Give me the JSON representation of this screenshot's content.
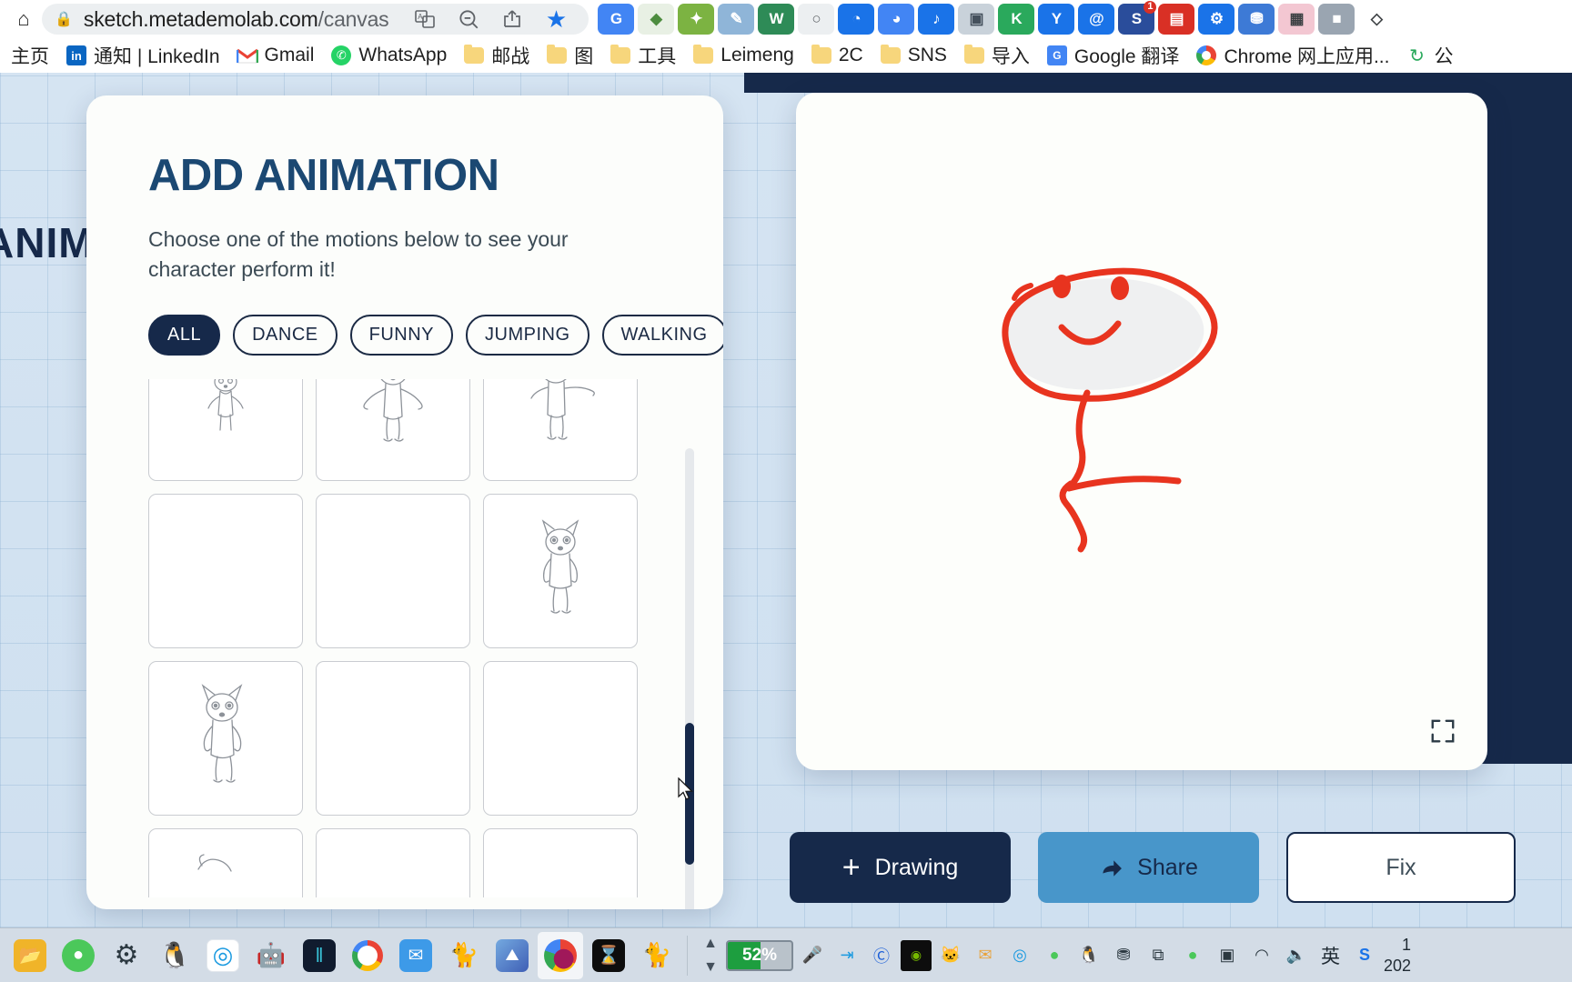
{
  "browser": {
    "home_icon": "home-icon",
    "lock_icon": "lock-icon",
    "url_main": "sketch.metademolab.com",
    "url_path": "/canvas",
    "translate_icon": "translate-icon",
    "zoom_out_icon": "zoom-out-icon",
    "share_icon": "share-icon",
    "bookmark_star_icon": "star-icon",
    "extensions": [
      {
        "name": "translate-extension",
        "glyph": "G",
        "color": "#4285f4",
        "badge": ""
      },
      {
        "name": "puzzle-extension",
        "glyph": "◆",
        "color": "#6aa84f",
        "badge": ""
      },
      {
        "name": "green-extension",
        "glyph": "✦",
        "color": "#6aa84f",
        "badge": ""
      },
      {
        "name": "pen-extension",
        "glyph": "✎",
        "color": "#7a9cc6",
        "badge": ""
      },
      {
        "name": "wps-extension",
        "glyph": "W",
        "color": "#2e8b57",
        "badge": ""
      },
      {
        "name": "circle-extension",
        "glyph": "○",
        "color": "#5f6368",
        "badge": ""
      },
      {
        "name": "blue-swirl-extension",
        "glyph": "◔",
        "color": "#1a73e8",
        "badge": ""
      },
      {
        "name": "cloud-extension",
        "glyph": "◕",
        "color": "#4285f4",
        "badge": ""
      },
      {
        "name": "music-extension",
        "glyph": "♪",
        "color": "#1a73e8",
        "badge": ""
      },
      {
        "name": "robot-extension",
        "glyph": "▣",
        "color": "#9aa5b1",
        "badge": ""
      },
      {
        "name": "kiwi-extension",
        "glyph": "K",
        "color": "#2aa95c",
        "badge": ""
      },
      {
        "name": "yandex-extension",
        "glyph": "Y",
        "color": "#1a73e8",
        "badge": ""
      },
      {
        "name": "mention-extension",
        "glyph": "@",
        "color": "#1a73e8",
        "badge": ""
      },
      {
        "name": "sales-extension",
        "glyph": "S",
        "color": "#2a4d9b",
        "badge": "1"
      },
      {
        "name": "megaphone-extension",
        "glyph": "◤",
        "color": "#d93025",
        "badge": ""
      },
      {
        "name": "settings-extension",
        "glyph": "⚙",
        "color": "#1a73e8",
        "badge": ""
      },
      {
        "name": "shield-extension",
        "glyph": "⛉",
        "color": "#3d7ad6",
        "badge": ""
      },
      {
        "name": "grid-extension",
        "glyph": "▦",
        "color": "#5f6368",
        "badge": ""
      },
      {
        "name": "camera-extension",
        "glyph": "■",
        "color": "#5f6368",
        "badge": ""
      },
      {
        "name": "puzzle-menu-icon",
        "glyph": "◇",
        "color": "#3c4043",
        "badge": ""
      }
    ],
    "bookmarks": [
      {
        "label": "主页",
        "icon": "none"
      },
      {
        "label": "通知 | LinkedIn",
        "icon": "linkedin"
      },
      {
        "label": "Gmail",
        "icon": "gmail"
      },
      {
        "label": "WhatsApp",
        "icon": "whatsapp"
      },
      {
        "label": "邮战",
        "icon": "folder"
      },
      {
        "label": "图",
        "icon": "folder"
      },
      {
        "label": "工具",
        "icon": "folder"
      },
      {
        "label": "Leimeng",
        "icon": "folder"
      },
      {
        "label": "2C",
        "icon": "folder"
      },
      {
        "label": "SNS",
        "icon": "folder"
      },
      {
        "label": "导入",
        "icon": "folder"
      },
      {
        "label": "Google 翻译",
        "icon": "gtranslate"
      },
      {
        "label": "Chrome 网上应用...",
        "icon": "chrome"
      },
      {
        "label": "公",
        "icon": "refresh"
      }
    ]
  },
  "ghost_heading": "ANIM",
  "panel": {
    "title": "ADD ANIMATION",
    "subtitle": "Choose one of the motions below to see your character perform it!",
    "filters": [
      {
        "label": "ALL",
        "active": true
      },
      {
        "label": "DANCE",
        "active": false
      },
      {
        "label": "FUNNY",
        "active": false
      },
      {
        "label": "JUMPING",
        "active": false
      },
      {
        "label": "WALKING",
        "active": false
      }
    ],
    "tiles": [
      {
        "name": "animation-tile-1",
        "pose": "small-standing"
      },
      {
        "name": "animation-tile-2",
        "pose": "arms-out"
      },
      {
        "name": "animation-tile-3",
        "pose": "arm-raised"
      },
      {
        "name": "animation-tile-4",
        "pose": "empty"
      },
      {
        "name": "animation-tile-5",
        "pose": "empty"
      },
      {
        "name": "animation-tile-6",
        "pose": "standing"
      },
      {
        "name": "animation-tile-7",
        "pose": "leaning"
      },
      {
        "name": "animation-tile-8",
        "pose": "empty"
      },
      {
        "name": "animation-tile-9",
        "pose": "empty"
      },
      {
        "name": "animation-tile-10",
        "pose": "partial"
      },
      {
        "name": "animation-tile-11",
        "pose": "empty"
      },
      {
        "name": "animation-tile-12",
        "pose": "empty"
      }
    ],
    "scrollbar": "vertical-scrollbar"
  },
  "canvas": {
    "drawing_name": "red-stick-figure-drawing",
    "expand_icon": "expand-fullscreen-icon"
  },
  "actions": {
    "drawing": {
      "label": "Drawing",
      "icon": "plus-icon",
      "color": "#16294a"
    },
    "share": {
      "label": "Share",
      "icon": "share-arrow-icon",
      "color": "#4896ca"
    },
    "fix": {
      "label": "Fix",
      "color": "#ffffff"
    }
  },
  "taskbar": {
    "apps": [
      {
        "name": "file-explorer",
        "glyph": "🗂",
        "color": "#f0b429",
        "active": false
      },
      {
        "name": "wechat",
        "glyph": "●",
        "color": "#4bc85a",
        "active": false
      },
      {
        "name": "settings",
        "glyph": "⚙",
        "color": "#3c4043",
        "active": false
      },
      {
        "name": "qq",
        "glyph": "●",
        "color": "#1f2a33",
        "active": false
      },
      {
        "name": "alibaba-cloud",
        "glyph": "◎",
        "color": "#1a9ae0",
        "active": false
      },
      {
        "name": "robot-assistant",
        "glyph": "▣",
        "color": "#9aa5b1",
        "active": false
      },
      {
        "name": "audio-editor",
        "glyph": "‖",
        "color": "#101b2e",
        "active": false
      },
      {
        "name": "chrome",
        "glyph": "◉",
        "color": "#ea4335",
        "active": false
      },
      {
        "name": "mail",
        "glyph": "✉",
        "color": "#3d9ae8",
        "active": false
      },
      {
        "name": "cat-app",
        "glyph": "▲",
        "color": "#27364a",
        "active": false
      },
      {
        "name": "photos",
        "glyph": "◰",
        "color": "#3f6fb5",
        "active": false
      },
      {
        "name": "chrome-canary",
        "glyph": "◉",
        "color": "#c0392b",
        "active": true
      },
      {
        "name": "timer-app",
        "glyph": "⧗",
        "color": "#0d0d0d",
        "active": false
      },
      {
        "name": "cat-app-2",
        "glyph": "▲",
        "color": "#27364a",
        "active": false
      }
    ],
    "battery_percent": "52%",
    "tray": [
      {
        "name": "microphone-tray-icon",
        "glyph": "🎤"
      },
      {
        "name": "export-tray-icon",
        "glyph": "↪"
      },
      {
        "name": "lenovo-tray-icon",
        "glyph": "Ⓛ"
      },
      {
        "name": "nvidia-tray-icon",
        "glyph": "◉"
      },
      {
        "name": "cat-tray-icon",
        "glyph": "◔"
      },
      {
        "name": "mail-tray-icon",
        "glyph": "✉"
      },
      {
        "name": "cloud-tray-icon",
        "glyph": "◎"
      },
      {
        "name": "wechat-tray-icon",
        "glyph": "●"
      },
      {
        "name": "qq-tray-icon",
        "glyph": "●"
      },
      {
        "name": "security-shield-tray-icon",
        "glyph": "⛉"
      },
      {
        "name": "screenshot-tray-icon",
        "glyph": "⧉"
      },
      {
        "name": "wechat-tray-icon-2",
        "glyph": "●"
      },
      {
        "name": "battery-tray-icon",
        "glyph": "▣"
      },
      {
        "name": "wifi-tray-icon",
        "glyph": "◠"
      },
      {
        "name": "volume-tray-icon",
        "glyph": "🔊"
      }
    ],
    "ime_label": "英",
    "sogou_label": "S",
    "clock_line1": "1",
    "clock_line2": "202"
  }
}
